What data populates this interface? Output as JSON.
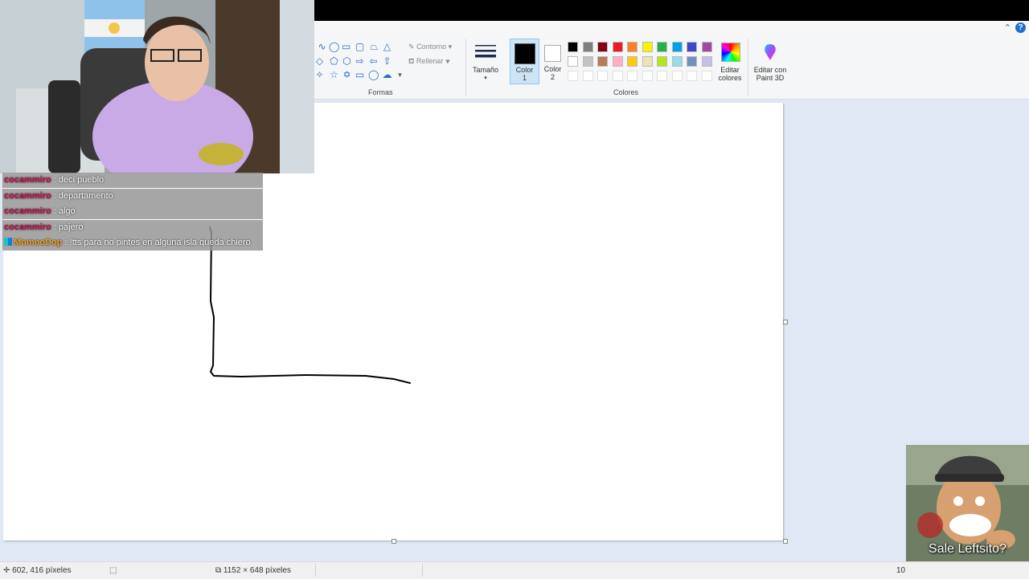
{
  "ribbon": {
    "shapes_group_label": "Formas",
    "outline_label": "Contorno",
    "fill_label": "Rellenar",
    "size_label": "Tamaño",
    "color1_label": "Color",
    "color1_num": "1",
    "color2_label": "Color",
    "color2_num": "2",
    "edit_colors_line1": "Editar",
    "edit_colors_line2": "colores",
    "paint3d_line1": "Editar con",
    "paint3d_line2": "Paint 3D",
    "colors_group_label": "Colores",
    "color1_value": "#000000",
    "color2_value": "#ffffff",
    "palette_row1": [
      "#000000",
      "#7f7f7f",
      "#880015",
      "#ed1c24",
      "#ff7f27",
      "#fff200",
      "#22b14c",
      "#00a2e8",
      "#3f48cc",
      "#a349a4"
    ],
    "palette_row2": [
      "#ffffff",
      "#c3c3c3",
      "#b97a57",
      "#ffaec9",
      "#ffc90e",
      "#efe4b0",
      "#b5e61d",
      "#99d9ea",
      "#7092be",
      "#c8bfe7"
    ]
  },
  "chat": [
    {
      "user": "cocammiro",
      "message": ": deci pueblo",
      "color": "#c2134a"
    },
    {
      "user": "cocammiro",
      "message": ": departamento",
      "color": "#c2134a"
    },
    {
      "user": "cocammiro",
      "message": ": algo",
      "color": "#c2134a"
    },
    {
      "user": "cocammiro",
      "message": ": pajero",
      "color": "#c2134a"
    },
    {
      "user": "MomooDop",
      "message": ": !tts para no pintes en alguna isla queda chiero",
      "color": "#f4a01d"
    }
  ],
  "statusbar": {
    "cursor_pos": "602, 416 píxeles",
    "canvas_size": "1152 × 648 píxeles",
    "zoom": "10"
  },
  "badge": {
    "text": "Sale Leftsito?"
  }
}
